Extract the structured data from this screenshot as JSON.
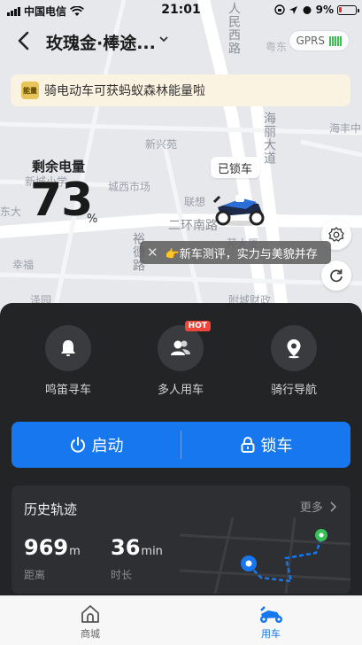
{
  "status_bar": {
    "carrier": "中国电信",
    "time": "21:01",
    "battery_pct": "9%"
  },
  "header": {
    "title": "玫瑰金·棒途...",
    "gprs": "GPRS"
  },
  "banner": {
    "icon_text": "能量",
    "text": "骑电动车可获蚂蚁森林能量啦"
  },
  "battery": {
    "label": "剩余电量",
    "value": "73",
    "unit": "%"
  },
  "vehicle": {
    "lock_status": "已锁车"
  },
  "toast": {
    "text": "👉新车测评，实力与美貌并存"
  },
  "map": {
    "labels": [
      "新城小学",
      "人民西路",
      "粤东",
      "海丰中",
      "海丽大道",
      "新兴苑",
      "城西市场",
      "联想",
      "二环南路",
      "裕德路",
      "附城财政",
      "幸福",
      "东大",
      "芹大厦",
      "泽园"
    ]
  },
  "functions": [
    {
      "label": "鸣笛寻车",
      "icon": "bell-icon"
    },
    {
      "label": "多人用车",
      "icon": "multi-user-icon",
      "badge": "HOT"
    },
    {
      "label": "骑行导航",
      "icon": "location-pin-icon"
    }
  ],
  "actions": {
    "start": "启动",
    "lock": "锁车"
  },
  "history": {
    "title": "历史轨迹",
    "more": "更多",
    "distance_value": "969",
    "distance_unit": "m",
    "distance_label": "距离",
    "duration_value": "36",
    "duration_unit": "min",
    "duration_label": "时长"
  },
  "tabs": [
    {
      "label": "商城",
      "icon": "home-icon",
      "active": false
    },
    {
      "label": "用车",
      "icon": "scooter-icon",
      "active": true
    }
  ],
  "colors": {
    "accent": "#1677ee",
    "panel": "#232426",
    "banner": "#fbf3e2"
  }
}
